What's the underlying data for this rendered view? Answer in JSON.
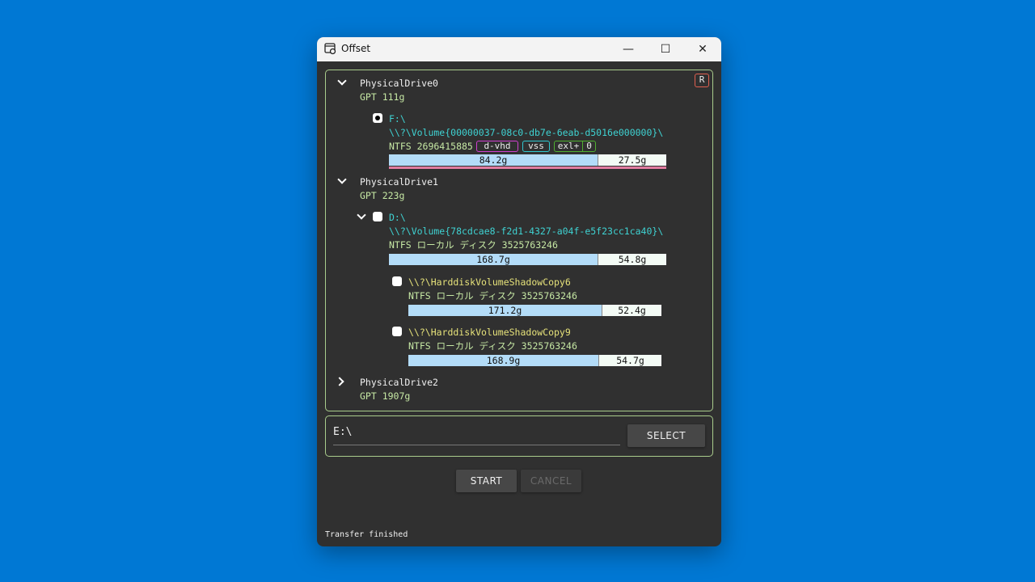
{
  "window": {
    "title": "Offset",
    "minimize": "—",
    "maximize": "☐",
    "close": "✕"
  },
  "refresh_label": "R",
  "drives": [
    {
      "name": "PhysicalDrive0",
      "info": "GPT 111g",
      "expanded": true,
      "volumes": [
        {
          "letter": "F:\\",
          "guid": "\\\\?\\Volume{00000037-08c0-db7e-6eab-d5016e000000}\\",
          "fs": "NTFS 2696415885",
          "used": "84.2g",
          "free": "27.5g",
          "used_fraction": 0.754,
          "selected": true,
          "badges": [
            {
              "label": "d-vhd",
              "color": "#d040d0"
            },
            {
              "label": "vss",
              "color": "#30c8d0"
            },
            {
              "label": "exl+",
              "color": "#50b030"
            },
            {
              "label": "0",
              "color": "#50b030"
            }
          ]
        }
      ]
    },
    {
      "name": "PhysicalDrive1",
      "info": "GPT 223g",
      "expanded": true,
      "volumes": [
        {
          "letter": "D:\\",
          "guid": "\\\\?\\Volume{78cdcae8-f2d1-4327-a04f-e5f23cc1ca40}\\",
          "fs": "NTFS ローカル ディスク 3525763246",
          "used": "168.7g",
          "free": "54.8g",
          "used_fraction": 0.755,
          "selected": false,
          "shadows": [
            {
              "path": "\\\\?\\HarddiskVolumeShadowCopy6",
              "fs": "NTFS ローカル ディスク 3525763246",
              "used": "171.2g",
              "free": "52.4g",
              "used_fraction": 0.766
            },
            {
              "path": "\\\\?\\HarddiskVolumeShadowCopy9",
              "fs": "NTFS ローカル ディスク 3525763246",
              "used": "168.9g",
              "free": "54.7g",
              "used_fraction": 0.755
            }
          ]
        }
      ]
    },
    {
      "name": "PhysicalDrive2",
      "info": "GPT 1907g",
      "expanded": false
    }
  ],
  "target": {
    "value": "E:\\",
    "select_label": "SELECT"
  },
  "actions": {
    "start": "START",
    "cancel": "CANCEL"
  },
  "status": "Transfer finished",
  "colors": {
    "accent_border": "#a9cc8c",
    "used_bar": "#b3dcf8",
    "refresh_border": "#e06050",
    "vss_line": "#e07ca0"
  }
}
